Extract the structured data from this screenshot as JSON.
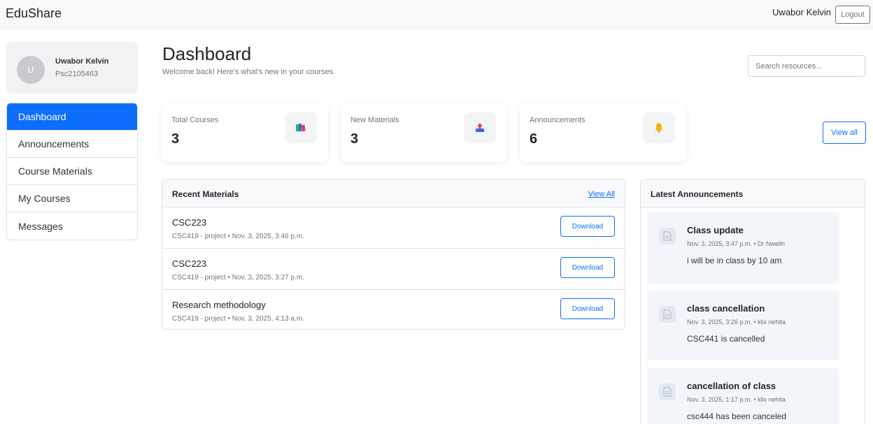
{
  "navbar": {
    "brand": "EduShare",
    "user_name": "Uwabor Kelvin",
    "logout_label": "Logout"
  },
  "profile": {
    "avatar_initial": "U",
    "name": "Uwabor Kelvin",
    "id": "Psc2105463"
  },
  "sidebar": {
    "items": [
      {
        "label": "Dashboard",
        "active": true
      },
      {
        "label": "Announcements"
      },
      {
        "label": "Course Materials"
      },
      {
        "label": "My Courses"
      },
      {
        "label": "Messages"
      }
    ]
  },
  "header": {
    "title": "Dashboard",
    "subtitle": "Welcome back! Here's what's new in your courses.",
    "search_placeholder": "Search resources..."
  },
  "stats": [
    {
      "label": "Total Courses",
      "value": "3",
      "icon": "books-icon"
    },
    {
      "label": "New Materials",
      "value": "3",
      "icon": "upload-icon"
    },
    {
      "label": "Announcements",
      "value": "6",
      "icon": "bell-icon"
    }
  ],
  "view_all_label": "View all",
  "recent_materials": {
    "title": "Recent Materials",
    "link": "View All",
    "download_label": "Download",
    "items": [
      {
        "title": "CSC223",
        "meta": "CSC419 - project • Nov. 3, 2025, 3:46 p.m."
      },
      {
        "title": "CSC223",
        "meta": "CSC419 - project • Nov. 3, 2025, 3:27 p.m."
      },
      {
        "title": "Research methodology",
        "meta": "CSC419 - project • Nov. 3, 2025, 4:13 a.m."
      }
    ]
  },
  "announcements": {
    "title": "Latest Announcements",
    "items": [
      {
        "title": "Class update",
        "meta": "Nov. 3, 2025, 3:47 p.m. • Dr Nwelih",
        "body": "i will be in class by 10 am"
      },
      {
        "title": "class cancellation",
        "meta": "Nov. 3, 2025, 3:26 p.m. • klix nehita",
        "body": "CSC441 is cancelled"
      },
      {
        "title": "cancellation of class",
        "meta": "Nov. 3, 2025, 1:17 p.m. • klix nehita",
        "body": "csc444 has been canceled"
      }
    ]
  },
  "colors": {
    "primary": "#0d6efd",
    "navbar_bg": "#f8f9fa",
    "muted": "#6c757d"
  }
}
